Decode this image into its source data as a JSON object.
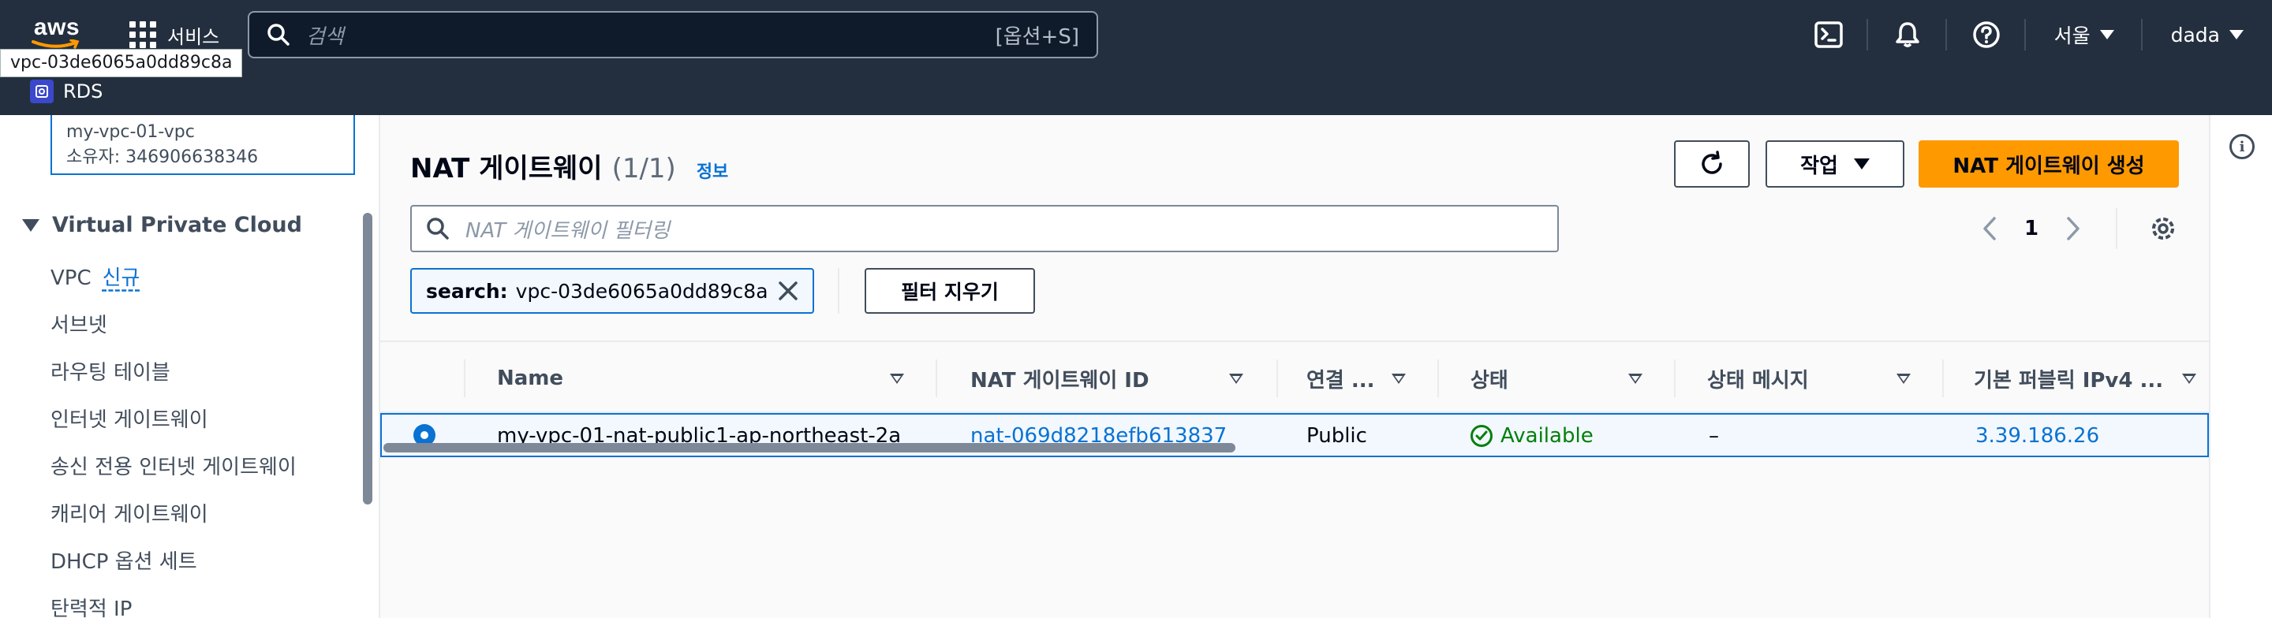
{
  "topnav": {
    "logo_text": "aws",
    "services_label": "서비스",
    "search_placeholder": "검색",
    "search_shortcut": "[옵션+S]",
    "region": "서울",
    "user": "dada",
    "tooltip": "vpc-03de6065a0dd89c8a",
    "favorite": "RDS",
    "icons": [
      "cloudshell-icon",
      "notifications-icon",
      "help-icon"
    ]
  },
  "sidebar": {
    "vpc_name": "my-vpc-01-vpc",
    "vpc_owner": "소유자: 346906638346",
    "section_title": "Virtual Private Cloud",
    "items": [
      {
        "label": "VPC",
        "badge": "신규"
      },
      {
        "label": "서브넷"
      },
      {
        "label": "라우팅 테이블"
      },
      {
        "label": "인터넷 게이트웨이"
      },
      {
        "label": "송신 전용 인터넷 게이트웨이"
      },
      {
        "label": "캐리어 게이트웨이"
      },
      {
        "label": "DHCP 옵션 세트"
      },
      {
        "label": "탄력적 IP"
      }
    ]
  },
  "main": {
    "title": "NAT 게이트웨이",
    "count": "(1/1)",
    "info_link": "정보",
    "actions_label": "작업",
    "create_label": "NAT 게이트웨이 생성",
    "filter_placeholder": "NAT 게이트웨이 필터링",
    "page": "1",
    "token_key": "search:",
    "token_value": "vpc-03de6065a0dd89c8a",
    "clear_filters": "필터 지우기"
  },
  "table": {
    "columns": [
      "Name",
      "NAT 게이트웨이 ID",
      "연결 ...",
      "상태",
      "상태 메시지",
      "기본 퍼블릭 IPv4 ..."
    ],
    "rows": [
      {
        "selected": true,
        "name": "my-vpc-01-nat-public1-ap-northeast-2a",
        "id": "nat-069d8218efb613837",
        "connectivity": "Public",
        "state": "Available",
        "state_message": "–",
        "public_ip": "3.39.186.26"
      }
    ]
  },
  "colors": {
    "nav_bg": "#232f3e",
    "accent": "#0972d3",
    "primary_button": "#ff9900",
    "success": "#037f0c"
  }
}
